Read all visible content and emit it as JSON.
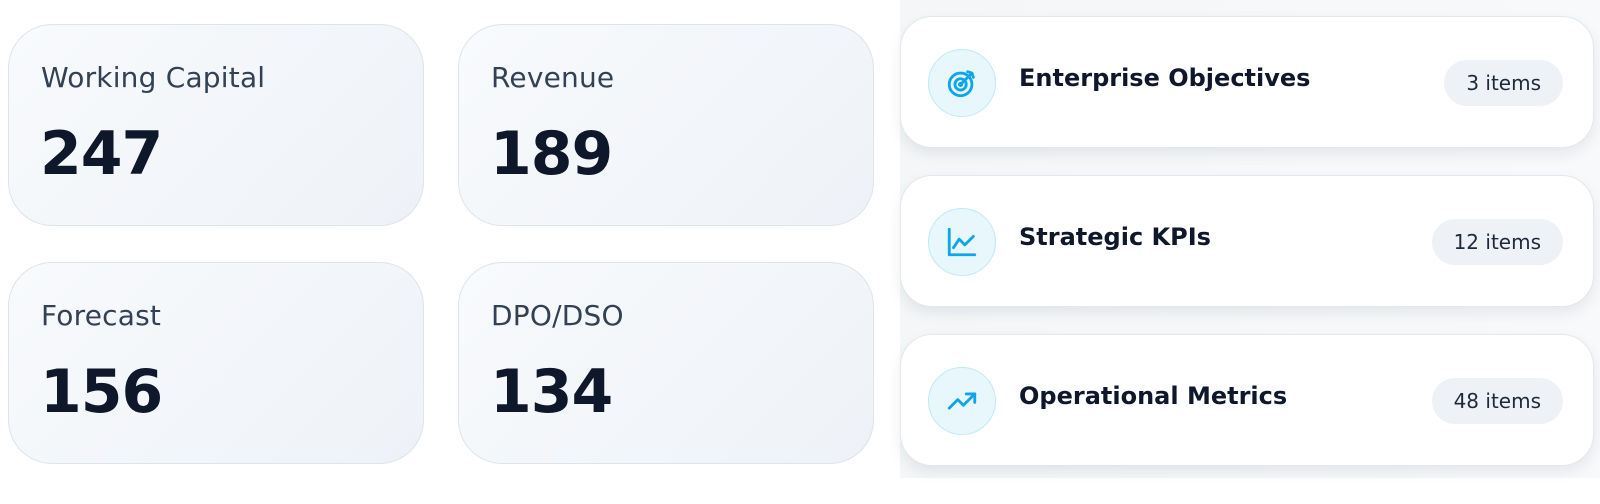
{
  "stats": [
    {
      "label": "Working Capital",
      "value": "247"
    },
    {
      "label": "Revenue",
      "value": "189"
    },
    {
      "label": "Forecast",
      "value": "156"
    },
    {
      "label": "DPO/DSO",
      "value": "134"
    }
  ],
  "categories": [
    {
      "label": "Enterprise Objectives",
      "count": "3 items",
      "icon": "target-icon"
    },
    {
      "label": "Strategic KPIs",
      "count": "12 items",
      "icon": "line-chart-icon"
    },
    {
      "label": "Operational Metrics",
      "count": "48 items",
      "icon": "trending-up-icon"
    }
  ],
  "colors": {
    "accent": "#0ea5e9",
    "icon_bg": "#e8f7fc",
    "text": "#0f172a"
  }
}
